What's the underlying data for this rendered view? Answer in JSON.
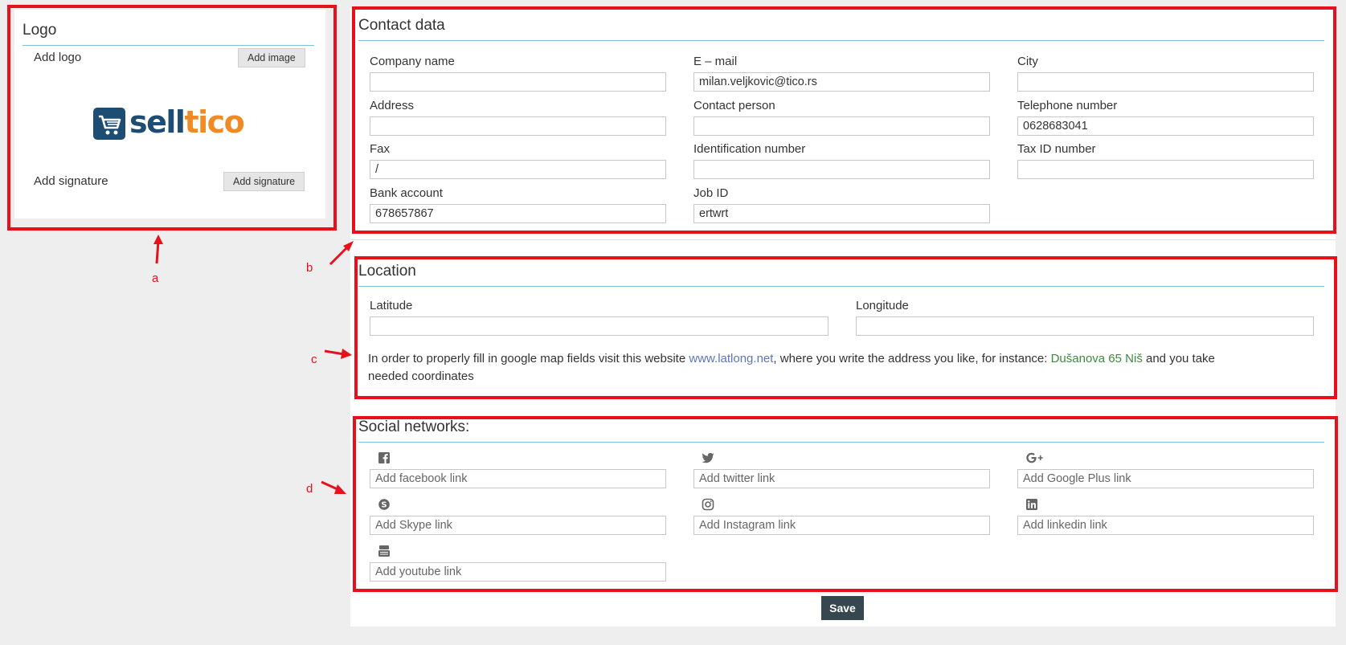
{
  "logo_section": {
    "title": "Logo",
    "add_logo_label": "Add logo",
    "add_image_button": "Add image",
    "brand_name": "selltico",
    "add_signature_label": "Add signature",
    "add_signature_button": "Add signature"
  },
  "contact": {
    "title": "Contact data",
    "fields": {
      "company_name": {
        "label": "Company name",
        "value": ""
      },
      "email": {
        "label": "E – mail",
        "value": "milan.veljkovic@tico.rs"
      },
      "city": {
        "label": "City",
        "value": ""
      },
      "address": {
        "label": "Address",
        "value": ""
      },
      "contact_person": {
        "label": "Contact person",
        "value": ""
      },
      "telephone": {
        "label": "Telephone number",
        "value": "0628683041"
      },
      "fax": {
        "label": "Fax",
        "value": "/"
      },
      "identification_number": {
        "label": "Identification number",
        "value": ""
      },
      "tax_id": {
        "label": "Tax ID number",
        "value": ""
      },
      "bank_account": {
        "label": "Bank account",
        "value": "678657867"
      },
      "job_id": {
        "label": "Job ID",
        "value": "ertwrt"
      }
    }
  },
  "location": {
    "title": "Location",
    "latitude": {
      "label": "Latitude",
      "value": ""
    },
    "longitude": {
      "label": "Longitude",
      "value": ""
    },
    "help_prefix": "In order to properly fill in google map fields visit this website ",
    "help_link": "www.latlong.net",
    "help_middle": ", where you write the address you like, for instance: ",
    "help_example": "Dušanova 65 Niš",
    "help_suffix": " and you take needed coordinates"
  },
  "social": {
    "title": "Social networks:",
    "facebook": {
      "icon": "facebook-icon",
      "placeholder": "Add facebook link"
    },
    "twitter": {
      "icon": "twitter-icon",
      "placeholder": "Add twitter link"
    },
    "google_plus": {
      "icon": "google-plus-icon",
      "placeholder": "Add Google Plus link"
    },
    "skype": {
      "icon": "skype-icon",
      "placeholder": "Add Skype link"
    },
    "instagram": {
      "icon": "instagram-icon",
      "placeholder": "Add Instagram link"
    },
    "linkedin": {
      "icon": "linkedin-icon",
      "placeholder": "Add linkedin link"
    },
    "youtube": {
      "icon": "youtube-icon",
      "placeholder": "Add youtube link"
    }
  },
  "save_button": "Save",
  "annotations": {
    "a": "a",
    "b": "b",
    "c": "c",
    "d": "d"
  },
  "colors": {
    "highlight": "#e8101a",
    "save": "#36474f",
    "brand_blue": "#1d4d73",
    "brand_orange": "#f08a24"
  }
}
